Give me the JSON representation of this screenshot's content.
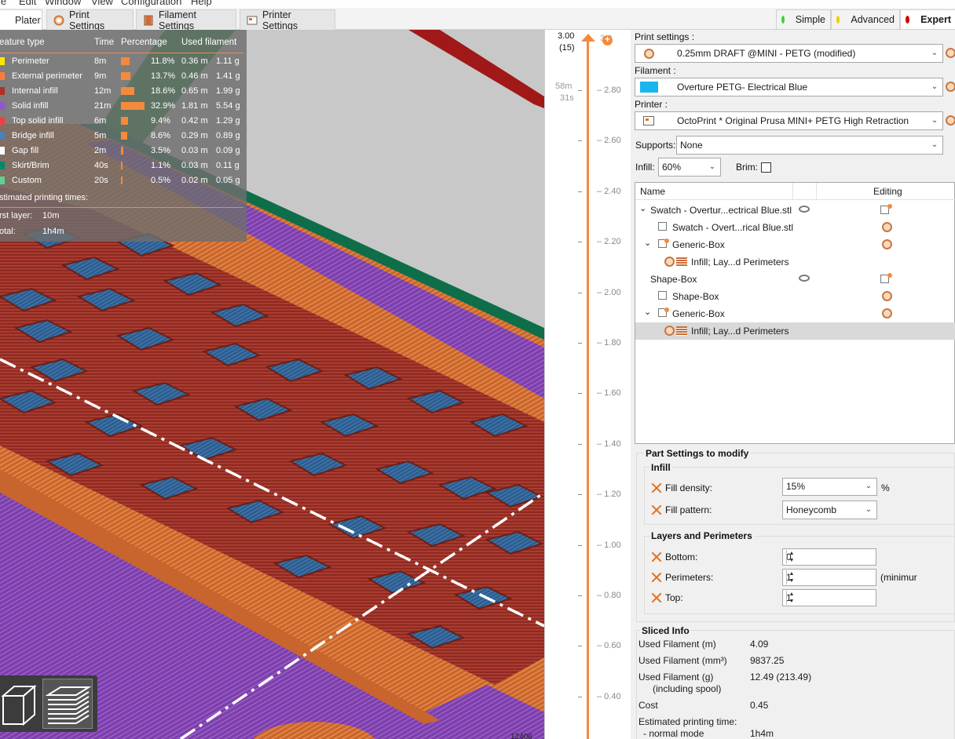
{
  "menu": [
    "le",
    "Edit",
    "Window",
    "View",
    "Configuration",
    "Help"
  ],
  "tabs": [
    {
      "label": "Plater",
      "icon": "plater-icon"
    },
    {
      "label": "Print Settings",
      "icon": "gear-icon"
    },
    {
      "label": "Filament Settings",
      "icon": "spool-icon"
    },
    {
      "label": "Printer Settings",
      "icon": "printer-icon"
    }
  ],
  "modes": [
    {
      "label": "Simple",
      "color": "#3bd13b"
    },
    {
      "label": "Advanced",
      "color": "#f0d000"
    },
    {
      "label": "Expert",
      "color": "#d00000"
    }
  ],
  "legend": {
    "headers": [
      "eature type",
      "Time",
      "Percentage",
      "Used filament"
    ],
    "rows": [
      {
        "name": "Perimeter",
        "color": "#ffe600",
        "time": "8m",
        "pct": "11.8%",
        "fraction": 0.118,
        "m": "0.36 m",
        "g": "1.11 g"
      },
      {
        "name": "External perimeter",
        "color": "#ff7d38",
        "time": "9m",
        "pct": "13.7%",
        "fraction": 0.137,
        "m": "0.46 m",
        "g": "1.41 g"
      },
      {
        "name": "Internal infill",
        "color": "#b03029",
        "time": "12m",
        "pct": "18.6%",
        "fraction": 0.186,
        "m": "0.65 m",
        "g": "1.99 g"
      },
      {
        "name": "Solid infill",
        "color": "#9654cc",
        "time": "21m",
        "pct": "32.9%",
        "fraction": 0.329,
        "m": "1.81 m",
        "g": "5.54 g"
      },
      {
        "name": "Top solid infill",
        "color": "#f04040",
        "time": "6m",
        "pct": "9.4%",
        "fraction": 0.094,
        "m": "0.42 m",
        "g": "1.29 g"
      },
      {
        "name": "Bridge infill",
        "color": "#4d80ba",
        "time": "5m",
        "pct": "8.6%",
        "fraction": 0.086,
        "m": "0.29 m",
        "g": "0.89 g"
      },
      {
        "name": "Gap fill",
        "color": "#ffffff",
        "time": "2m",
        "pct": "3.5%",
        "fraction": 0.035,
        "m": "0.03 m",
        "g": "0.09 g"
      },
      {
        "name": "Skirt/Brim",
        "color": "#00876e",
        "time": "40s",
        "pct": "1.1%",
        "fraction": 0.011,
        "m": "0.03 m",
        "g": "0.11 g"
      },
      {
        "name": "Custom",
        "color": "#5ed194",
        "time": "20s",
        "pct": "0.5%",
        "fraction": 0.005,
        "m": "0.02 m",
        "g": "0.05 g"
      }
    ],
    "est_title": "stimated printing times:",
    "first_layer_label": "rst layer:",
    "first_layer_value": "10m",
    "total_label": "otal:",
    "total_value": "1h4m"
  },
  "slider": {
    "top_value": "3.00",
    "top_layer": "(15)",
    "est_time_1": "58m",
    "est_time_2": "31s",
    "ticks": [
      "2.80",
      "2.60",
      "2.40",
      "2.20",
      "2.00",
      "1.80",
      "1.60",
      "1.40",
      "1.20",
      "1.00",
      "0.80",
      "0.60",
      "0.40"
    ],
    "partial_top": "3.0"
  },
  "viewport_bottom_label": "12406",
  "sidebar": {
    "print_settings_label": "Print settings :",
    "print_settings_value": "0.25mm DRAFT @MINI - PETG (modified)",
    "filament_label": "Filament :",
    "filament_value": "Overture PETG- Electrical Blue",
    "filament_color": "#1ab4f0",
    "printer_label": "Printer :",
    "printer_value": "OctoPrint * Original Prusa MINI+ PETG High Retraction",
    "supports_label": "Supports:",
    "supports_value": "None",
    "infill_label": "Infill:",
    "infill_value": "60%",
    "brim_label": "Brim:"
  },
  "tree": {
    "col_name": "Name",
    "col_editing": "Editing",
    "rows": [
      {
        "label": "Swatch - Overtur...ectrical Blue.stl"
      },
      {
        "label": "Swatch - Overt...rical Blue.stl"
      },
      {
        "label": "Generic-Box"
      },
      {
        "label": "Infill; Lay...d Perimeters"
      },
      {
        "label": "Shape-Box"
      },
      {
        "label": "Shape-Box"
      },
      {
        "label": "Generic-Box"
      },
      {
        "label": "Infill; Lay...d Perimeters"
      }
    ]
  },
  "part_settings": {
    "title": "Part Settings to modify",
    "infill_group": "Infill",
    "fill_density_label": "Fill density:",
    "fill_density_value": "15%",
    "fill_density_unit": "%",
    "fill_pattern_label": "Fill pattern:",
    "fill_pattern_value": "Honeycomb",
    "layers_group": "Layers and Perimeters",
    "bottom_label": "Bottom:",
    "bottom_value": "0",
    "perimeters_label": "Perimeters:",
    "perimeters_value": "1",
    "perimeters_note": "(minimur",
    "top_label": "Top:",
    "top_value": "1"
  },
  "sliced_info": {
    "title": "Sliced Info",
    "used_m_label": "Used Filament (m)",
    "used_m_value": "4.09",
    "used_mm3_label": "Used Filament (mm³)",
    "used_mm3_value": "9837.25",
    "used_g_label": "Used Filament (g)",
    "used_g_sub": "(including spool)",
    "used_g_value": "12.49 (213.49)",
    "cost_label": "Cost",
    "cost_value": "0.45",
    "est_label": "Estimated printing time:",
    "normal_mode_label": "- normal mode",
    "normal_mode_value": "1h4m"
  }
}
